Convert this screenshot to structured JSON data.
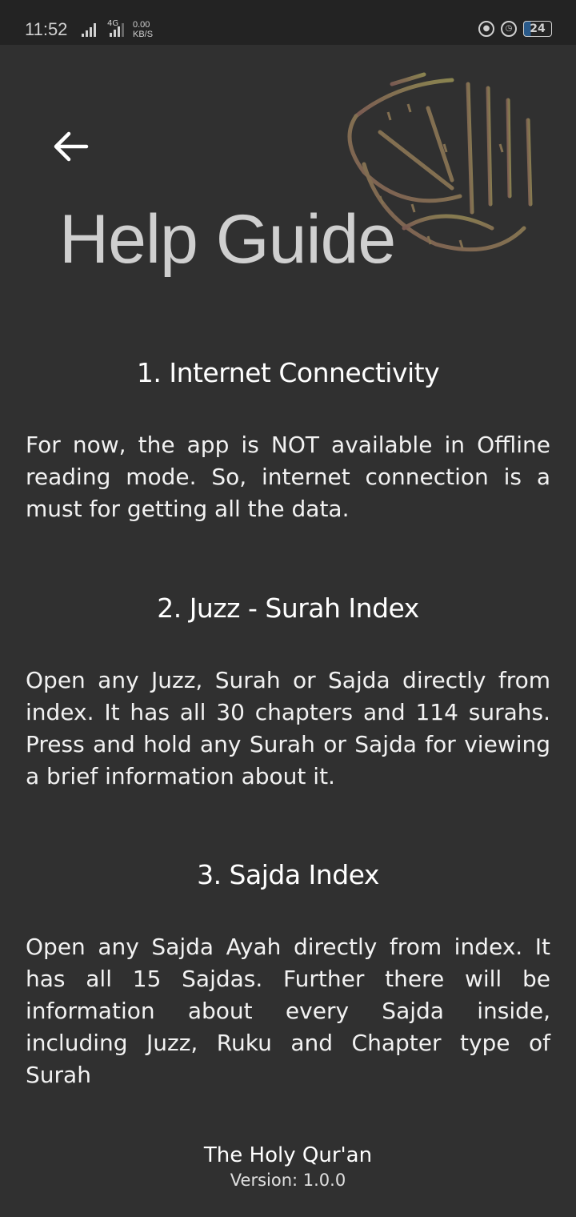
{
  "status_bar": {
    "time": "11:52",
    "network": "4G",
    "speed_value": "0.00",
    "speed_unit": "KB/S",
    "battery": "24"
  },
  "header": {
    "title": "Help Guide",
    "back_icon": "arrow-left-icon",
    "logo": "quran-calligraphy-logo"
  },
  "sections": [
    {
      "heading": "1. Internet Connectivity",
      "body": "For now, the app is NOT available in Offline reading mode. So, internet connection is a must for getting all the data."
    },
    {
      "heading": "2. Juzz - Surah Index",
      "body": "Open any Juzz, Surah or Sajda directly from index. It has all 30 chapters and 114 surahs. Press and hold any Surah or Sajda for viewing a brief information about it."
    },
    {
      "heading": "3. Sajda Index",
      "body": "Open any Sajda Ayah directly from index. It has all 15 Sajdas. Further there will be information about every Sajda inside, including Juzz, Ruku and Chapter type of Surah"
    }
  ],
  "footer": {
    "app_name": "The Holy Qur'an",
    "version": "Version: 1.0.0"
  },
  "colors": {
    "background": "#303030",
    "status_bar": "#232323",
    "title": "#cfcfcf"
  }
}
